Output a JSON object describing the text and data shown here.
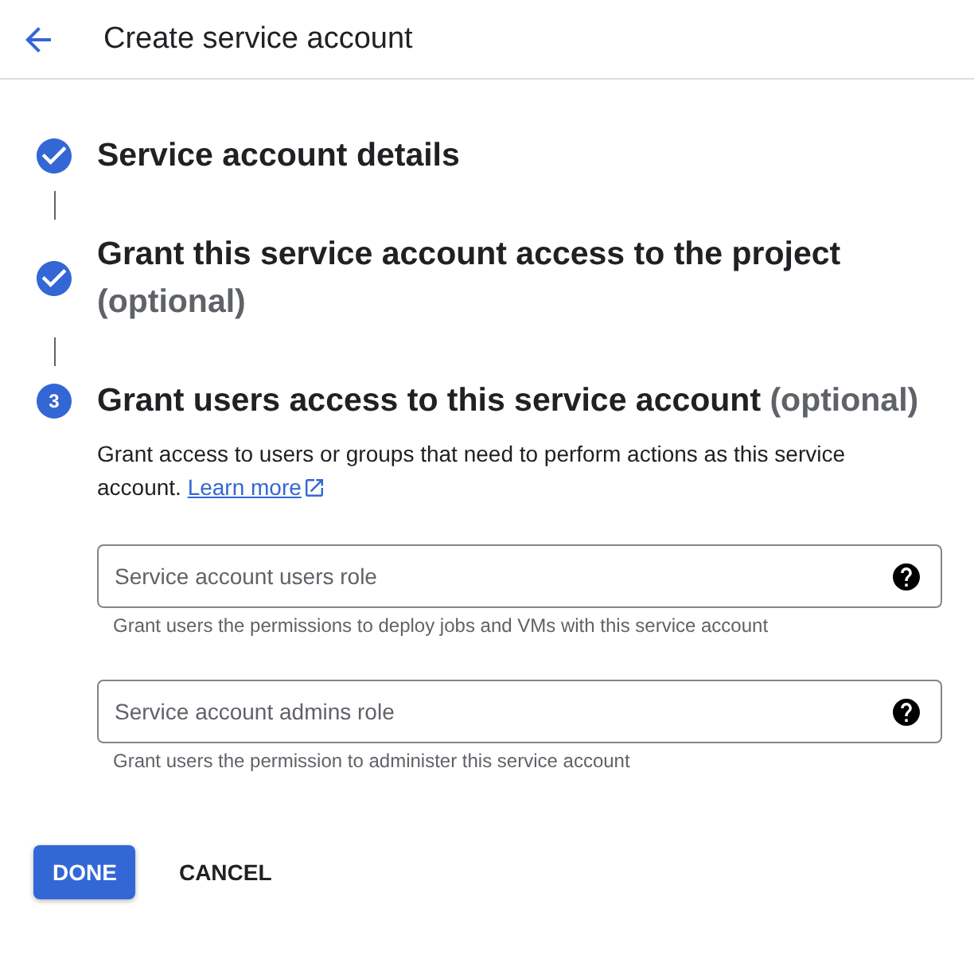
{
  "header": {
    "title": "Create service account"
  },
  "steps": [
    {
      "completed": true,
      "title": "Service account details"
    },
    {
      "completed": true,
      "title": "Grant this service account access to the project",
      "optional_note": "(optional)"
    },
    {
      "completed": false,
      "number": "3",
      "title": "Grant users access to this service account",
      "optional_note": "(optional)",
      "description": "Grant access to users or groups that need to perform actions as this service account.",
      "link": "Learn more",
      "fields": [
        {
          "placeholder": "Service account users role",
          "hint": "Grant users the permissions to deploy jobs and VMs with this service account"
        },
        {
          "placeholder": "Service account admins role",
          "hint": "Grant users the permission to administer this service account"
        }
      ]
    }
  ],
  "buttons": [
    {
      "kind": "primary",
      "label": "DONE"
    },
    {
      "kind": "text",
      "label": "CANCEL"
    }
  ]
}
